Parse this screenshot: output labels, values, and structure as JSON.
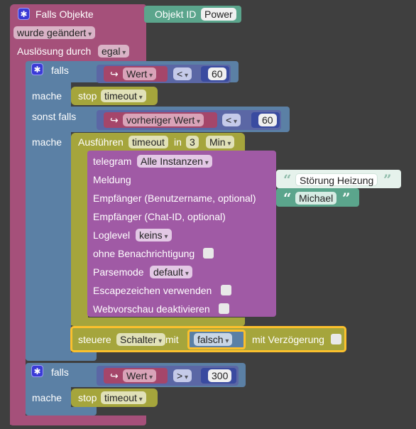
{
  "root": {
    "title": "Falls Objekte",
    "object_label": "Objekt ID",
    "object_value": "Power",
    "changed_dropdown": "wurde geändert",
    "trigger_label": "Auslösung durch",
    "trigger_value": "egal"
  },
  "if1": {
    "if_label": "falls",
    "var": "Wert",
    "op": "<",
    "num": "60",
    "do_label": "mache",
    "stop_label": "stop",
    "stop_value": "timeout",
    "elseif_label": "sonst falls",
    "var2": "vorheriger Wert",
    "op2": "<",
    "num2": "60",
    "do2_label": "mache"
  },
  "delay": {
    "run_label": "Ausführen",
    "timer_value": "timeout",
    "in_label": "in",
    "amount": "3",
    "unit": "Min"
  },
  "telegram": {
    "label": "telegram",
    "instance": "Alle Instanzen",
    "message_label": "Meldung",
    "message_value": "Störung Heizung",
    "recipient_label": "Empfänger (Benutzername, optional)",
    "recipient_value": "Michael",
    "chatid_label": "Empfänger (Chat-ID, optional)",
    "loglevel_label": "Loglevel",
    "loglevel_value": "keins",
    "silent_label": "ohne Benachrichtigung",
    "parsemode_label": "Parsemode",
    "parsemode_value": "default",
    "escape_label": "Escapezeichen verwenden",
    "preview_label": "Webvorschau deaktivieren"
  },
  "control": {
    "label": "steuere",
    "target": "Schalter",
    "with_label": "mit",
    "value": "falsch",
    "delay_label": "mit Verzögerung"
  },
  "if2": {
    "if_label": "falls",
    "var": "Wert",
    "op": ">",
    "num": "300",
    "do_label": "mache",
    "stop_label": "stop",
    "stop_value": "timeout"
  },
  "colors": {
    "background": "#3f3f3f",
    "trigger_block": "#a5507a",
    "logic_block": "#5b80a5",
    "var_block": "#a5466a",
    "math_block": "#5b67a5",
    "timer_block": "#a5a53c",
    "telegram_block": "#a05aa5",
    "text_block": "#5ba58c",
    "highlight": "#fbc02d",
    "gear": "#3a3ad6"
  },
  "icons": [
    "gear-icon",
    "return-arrow-icon",
    "quote-icon",
    "dropdown-arrow-icon",
    "checkbox"
  ]
}
